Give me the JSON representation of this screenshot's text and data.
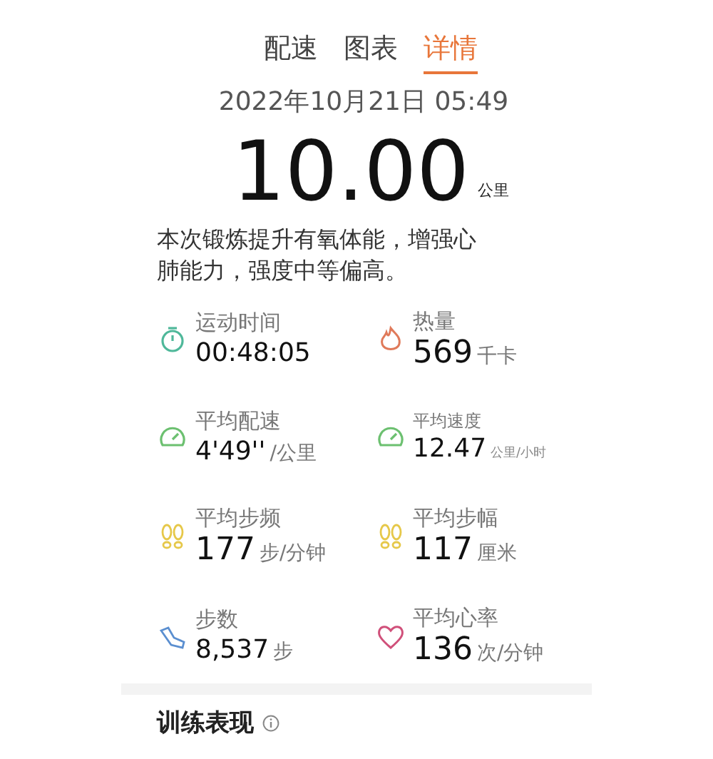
{
  "tabs": [
    {
      "label": "配速",
      "selected": false
    },
    {
      "label": "图表",
      "selected": false
    },
    {
      "label": "详情",
      "selected": true
    }
  ],
  "date": "2022年10月21日 05:49",
  "distance": {
    "value": "10.00",
    "unit": "公里"
  },
  "summary": "本次锻炼提升有氧体能，增强心肺能力，强度中等偏高。",
  "metrics": [
    {
      "kind": "duration",
      "label": "运动时间",
      "value": "00:48:05",
      "color": "#4fb89a"
    },
    {
      "kind": "calories",
      "label": "热量",
      "value": "569",
      "unit": "千卡",
      "color": "#e07a5a"
    },
    {
      "kind": "pace",
      "label": "平均配速",
      "value": "4'49''",
      "unit": "/公里",
      "color": "#6cc070"
    },
    {
      "kind": "speed",
      "label": "平均速度",
      "value": "12.47",
      "unit": "公里/小时",
      "color": "#6cc070"
    },
    {
      "kind": "cadence",
      "label": "平均步频",
      "value": "177",
      "unit": "步/分钟",
      "color": "#e6c84a"
    },
    {
      "kind": "stride",
      "label": "平均步幅",
      "value": "117",
      "unit": "厘米",
      "color": "#e6c84a"
    },
    {
      "kind": "steps",
      "label": "步数",
      "value": "8,537",
      "unit": "步",
      "color": "#5b8fd0"
    },
    {
      "kind": "heart_rate",
      "label": "平均心率",
      "value": "136",
      "unit": "次/分钟",
      "color": "#d0507a"
    }
  ],
  "section": {
    "title": "训练表现"
  }
}
